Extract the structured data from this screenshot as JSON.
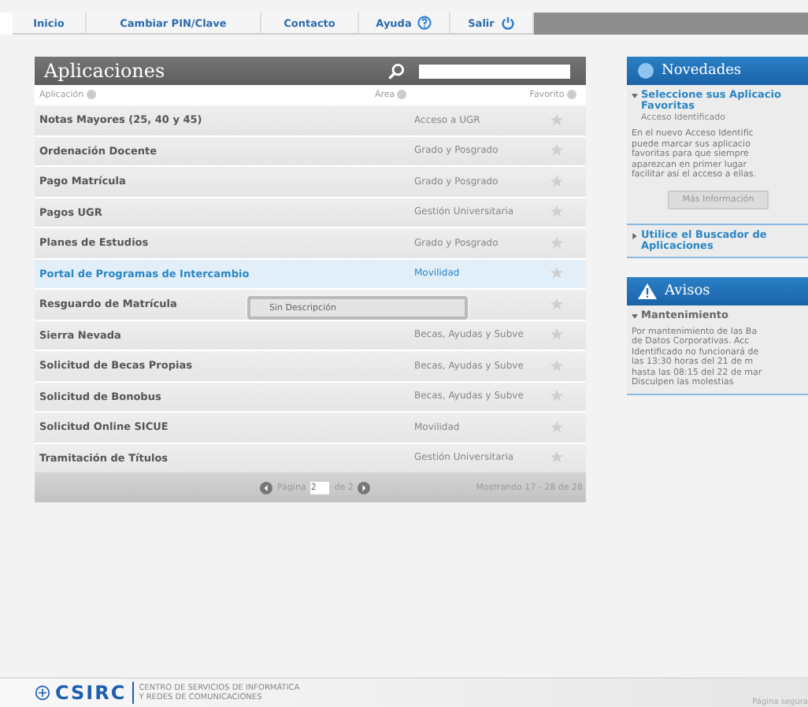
{
  "nav": [
    {
      "label": "Inicio",
      "kind": "plain"
    },
    {
      "label": "Cambiar PIN/Clave",
      "kind": "plain"
    },
    {
      "label": "Contacto",
      "kind": "plain"
    },
    {
      "label": "Ayuda",
      "kind": "help"
    },
    {
      "label": "Salir",
      "kind": "logout"
    }
  ],
  "apps": {
    "title": "Aplicaciones",
    "columns": [
      "Aplicación",
      "Área",
      "Favorito"
    ],
    "rows": [
      {
        "name": "Notas Mayores (25, 40 y 45)",
        "area": "Acceso a UGR",
        "selected": false,
        "favorite": false
      },
      {
        "name": "Ordenación Docente",
        "area": "Grado y Posgrado",
        "selected": false,
        "favorite": false
      },
      {
        "name": "Pago Matrícula",
        "area": "Grado y Posgrado",
        "selected": false,
        "favorite": false
      },
      {
        "name": "Pagos UGR",
        "area": "Gestión Universitaria",
        "selected": false,
        "favorite": false
      },
      {
        "name": "Planes de Estudios",
        "area": "Grado y Posgrado",
        "selected": false,
        "favorite": false
      },
      {
        "name": "Portal de Programas de Intercambio",
        "area": "Movilidad",
        "selected": true,
        "favorite": false
      },
      {
        "name": "Resguardo de Matrícula",
        "area": "",
        "selected": false,
        "favorite": false
      },
      {
        "name": "Sierra Nevada",
        "area": "Becas, Ayudas y Subve",
        "selected": false,
        "favorite": false
      },
      {
        "name": "Solicitud de Becas Propias",
        "area": "Becas, Ayudas y Subve",
        "selected": false,
        "favorite": false
      },
      {
        "name": "Solicitud de Bonobus",
        "area": "Becas, Ayudas y Subve",
        "selected": false,
        "favorite": false
      },
      {
        "name": "Solicitud Online SICUE",
        "area": "Movilidad",
        "selected": false,
        "favorite": false
      },
      {
        "name": "Tramitación de Títulos",
        "area": "Gestión Universitaria",
        "selected": false,
        "favorite": false
      }
    ],
    "tooltip": "Sin Descripción",
    "pager": {
      "page_label": "Página",
      "page": "2",
      "of": "de 2",
      "showing": "Mostrando 17 - 28 de 28"
    }
  },
  "news": {
    "title": "Novedades",
    "items": [
      {
        "title": "Seleccione sus Aplicacio Favoritas",
        "expanded": true,
        "subtitle": "Acceso Identificado",
        "lines": [
          "En el nuevo Acceso Identific",
          "puede marcar sus aplicacio",
          "favoritas para que siempre",
          "aparezcan en primer lugar",
          "facilitar así el acceso a ellas."
        ],
        "button": "Más Información"
      },
      {
        "title": "Utilice el Buscador de Aplicaciones",
        "expanded": false
      }
    ]
  },
  "notices": {
    "title": "Avisos",
    "items": [
      {
        "title": "Mantenimiento",
        "expanded": true,
        "lines": [
          "Por mantenimiento de las Ba",
          "de Datos Corporativas. Acc",
          "Identificado no funcionará de",
          "las 13:30 horas del 21 de m",
          "hasta las 08:15 del 22 de mar",
          "Disculpen las molestias"
        ]
      }
    ]
  },
  "footer": {
    "logo": "CSIRC",
    "org_lines": [
      "CENTRO DE SERVICIOS DE INFORMÁTICA",
      "Y REDES DE COMUNICACIONES"
    ],
    "secure": "Página segura"
  }
}
